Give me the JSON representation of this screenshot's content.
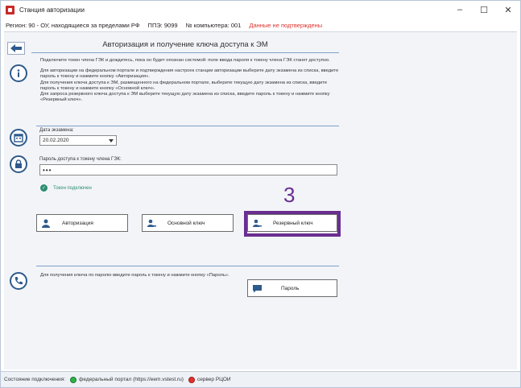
{
  "window": {
    "title": "Станция авторизации",
    "controls": {
      "minimize": "–",
      "maximize": "☐",
      "close": "✕"
    }
  },
  "info": {
    "region": "Регион: 90 - ОУ, находящиеся за пределами РФ",
    "ppe": "ППЭ: 9099",
    "computer": "№ компьютера: 001",
    "warning": "Данные не подтверждены"
  },
  "page": {
    "title": "Авторизация и получение ключа доступа к ЭМ",
    "instructions": [
      "Подключите токен члена ГЭК и дождитесь, пока он будет опознан системой: поле ввода пароля к токену члена ГЭК станет доступно.",
      "Для авторизации на федеральном портале и подтверждения настроек станции авторизации выберите дату экзамена из списка, введите пароль к токену и нажмите кнопку «Авторизация».\nДля получения ключа доступа к ЭМ, размещенного на федеральном портале, выберите текущую дату экзамена из списка, введите пароль к токену и нажмите кнопку «Основной ключ».\nДля запроса резервного ключа доступа к ЭМ выберите текущую дату экзамена из списка, введите пароль к токену и нажмите кнопку «Резервный ключ»."
    ]
  },
  "form": {
    "exam_date_label": "Дата экзамена:",
    "exam_date_value": "20.02.2020",
    "password_label": "Пароль доступа к токену члена ГЭК:",
    "password_value": "•••",
    "token_status": "Токен подключен"
  },
  "buttons": {
    "auth": "Авторизация",
    "main_key": "Основной ключ",
    "reserve_key": "Резервный ключ",
    "password": "Пароль"
  },
  "annotation": {
    "step": "3",
    "color": "#6a2e91"
  },
  "phone": {
    "text": "Для получения ключа по паролю введите пароль к токену и нажмите кнопку «Пароль»."
  },
  "status": {
    "label": "Состояние подключения:",
    "federal_portal": "федеральный портал (https://eem.vstest.ru)",
    "rcoi": "сервер РЦОИ"
  },
  "colors": {
    "accent": "#2e5a8c",
    "warning": "#e0312d",
    "ok": "#2c8e6f"
  }
}
